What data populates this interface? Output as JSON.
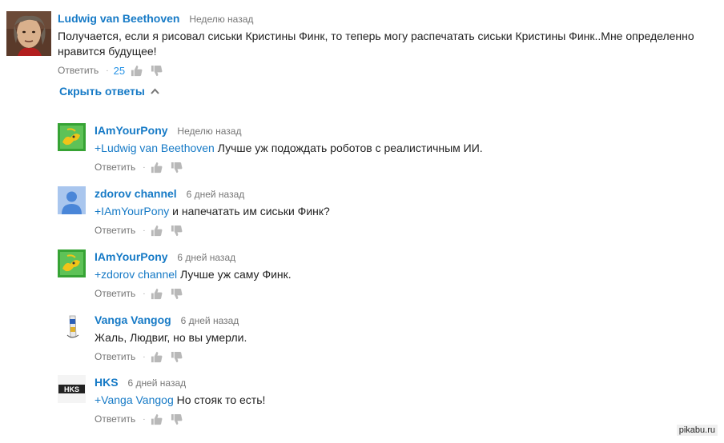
{
  "main_comment": {
    "author": "Ludwig van Beethoven",
    "time": "Неделю назад",
    "text_line1": "Получается, если я рисовал сиськи Кристины Финк, то теперь могу распечатать сиськи Кристины Финк..Мне определенно",
    "text_line2": "нравится будущее!",
    "reply_label": "Ответить",
    "dot": "·",
    "likes": "25"
  },
  "toggle_label": "Скрыть ответы",
  "replies": [
    {
      "author": "IAmYourPony",
      "time": "Неделю назад",
      "mention": "+Ludwig van Beethoven",
      "text": " Лучше уж подождать роботов с реалистичным ИИ.",
      "reply_label": "Ответить",
      "dot": "·"
    },
    {
      "author": "zdorov channel",
      "time": "6 дней назад",
      "mention": "+IAmYourPony",
      "text": " и напечатать им сиськи Финк?",
      "reply_label": "Ответить",
      "dot": "·"
    },
    {
      "author": "IAmYourPony",
      "time": "6 дней назад",
      "mention": "+zdorov channel",
      "text": " Лучше уж саму Финк.",
      "reply_label": "Ответить",
      "dot": "·"
    },
    {
      "author": "Vanga Vangog",
      "time": "6 дней назад",
      "mention": "",
      "text": "Жаль, Людвиг, но вы умерли.",
      "reply_label": "Ответить",
      "dot": "·"
    },
    {
      "author": "HKS",
      "time": "6 дней назад",
      "mention": "+Vanga Vangog",
      "text": " Но стояк то есть!",
      "reply_label": "Ответить",
      "dot": "·"
    }
  ],
  "avatar_text_hks": "HKS",
  "watermark": "pikabu.ru",
  "colors": {
    "link": "#167ac6",
    "muted": "#767676",
    "likes": "#2793e6"
  }
}
